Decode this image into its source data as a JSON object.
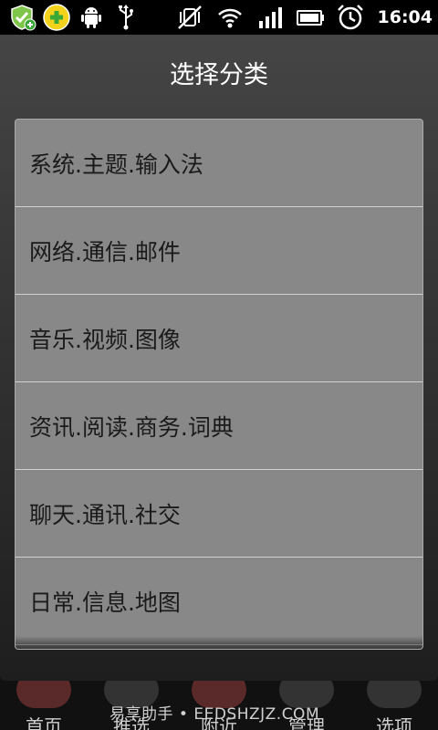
{
  "status_bar": {
    "icons": [
      "shield-check-icon",
      "plus-circle-icon",
      "android-icon",
      "usb-icon",
      "vibrate-off-icon",
      "wifi-icon",
      "signal-icon",
      "battery-icon",
      "alarm-clock-icon"
    ],
    "time": "16:04"
  },
  "dialog": {
    "title": "选择分类",
    "items": [
      {
        "label": "系统.主题.输入法"
      },
      {
        "label": "网络.通信.邮件"
      },
      {
        "label": "音乐.视频.图像"
      },
      {
        "label": "资讯.阅读.商务.词典"
      },
      {
        "label": "聊天.通讯.社交"
      },
      {
        "label": "日常.信息.地图"
      }
    ]
  },
  "bottom_nav": {
    "items": [
      {
        "label": "首页"
      },
      {
        "label": "推选"
      },
      {
        "label": "附近"
      },
      {
        "label": "管理"
      },
      {
        "label": "选项"
      }
    ]
  },
  "watermark": "易享助手 • EEDSHZJZ.COM",
  "colors": {
    "dialog_top": "#454545",
    "dialog_bottom": "#1e1e1e",
    "list_bg": "#888888",
    "divider": "#d0d0d0",
    "status_bar": "#000000"
  }
}
